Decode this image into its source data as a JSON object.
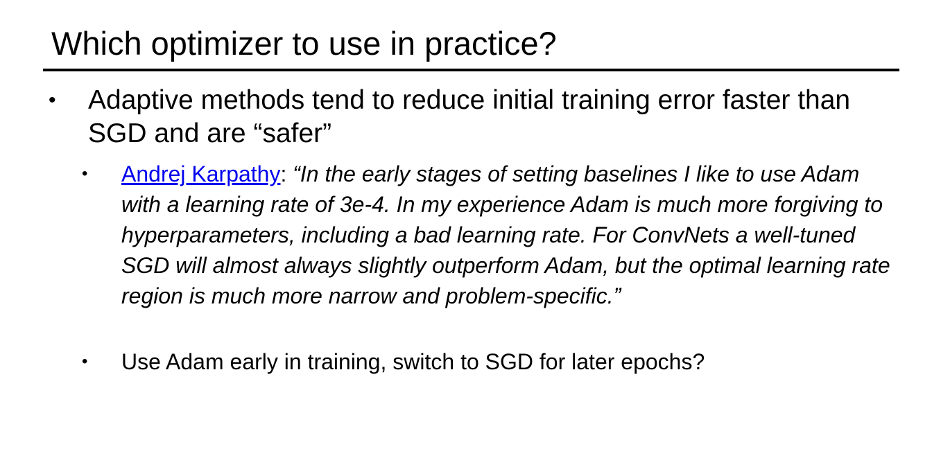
{
  "slide": {
    "title": "Which optimizer to use in practice?",
    "bullets": [
      {
        "marker": "•",
        "text": "Adaptive methods tend to reduce initial training error faster than SGD and are “safer”",
        "sub_bullets": [
          {
            "marker": "•",
            "link_text": "Andrej Karpathy",
            "separator": ": ",
            "quote": "“In the early stages of setting baselines I like to use Adam with a learning rate of 3e-4. In my experience Adam is much more forgiving to hyperparameters, including a bad learning rate. For ConvNets a well-tuned SGD will almost always slightly outperform Adam, but the optimal learning rate region is much more narrow and problem-specific.”"
          },
          {
            "marker": "•",
            "text": "Use Adam early in training, switch to SGD for later epochs?"
          }
        ]
      }
    ]
  },
  "colors": {
    "text": "#000000",
    "link": "#0000ee",
    "background": "#ffffff"
  }
}
